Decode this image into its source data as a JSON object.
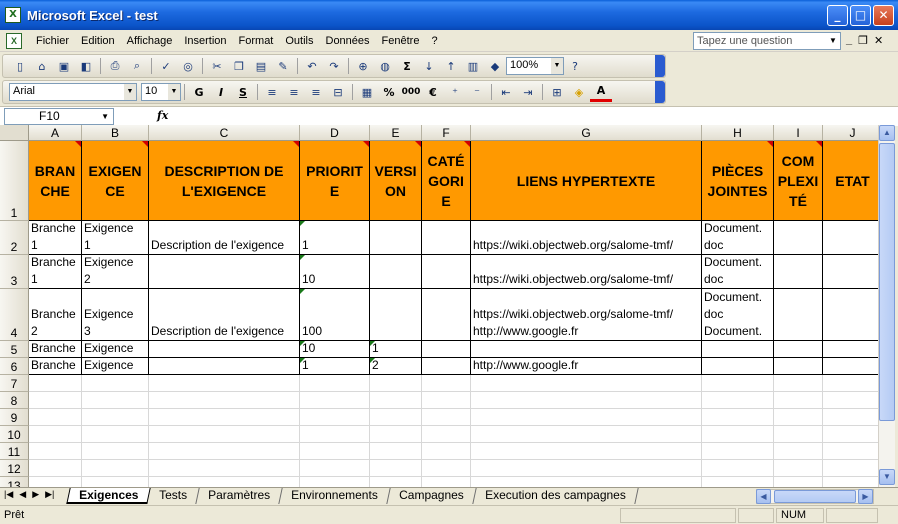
{
  "window": {
    "title": "Microsoft Excel - test",
    "app_icon": "excel-icon"
  },
  "menu": {
    "items": [
      "Fichier",
      "Edition",
      "Affichage",
      "Insertion",
      "Format",
      "Outils",
      "Données",
      "Fenêtre",
      "?"
    ],
    "question_placeholder": "Tapez une question"
  },
  "toolbar": {
    "zoom": "100%",
    "font_name": "Arial",
    "font_size": "10",
    "bold_label": "G",
    "italic_label": "I",
    "underline_label": "S",
    "sum_label": "Σ",
    "percent_label": "%",
    "thousands_label": "000",
    "euro_label": "€"
  },
  "formula_bar": {
    "cell_ref": "F10",
    "fx_label": "fx",
    "value": ""
  },
  "grid": {
    "columns": [
      "A",
      "B",
      "C",
      "D",
      "E",
      "F",
      "G",
      "H",
      "I",
      "J"
    ],
    "rows": [
      "1",
      "2",
      "3",
      "4",
      "5",
      "6",
      "7",
      "8",
      "9",
      "10",
      "11",
      "12",
      "13"
    ],
    "headers": [
      [
        "BRAN",
        "CHE"
      ],
      [
        "EXIGEN",
        "CE"
      ],
      [
        "DESCRIPTION DE",
        "L'EXIGENCE"
      ],
      [
        "PRIORIT",
        "E"
      ],
      [
        "VERSI",
        "ON"
      ],
      [
        "CATÉ",
        "GORI",
        "E"
      ],
      [
        "LIENS HYPERTEXTE"
      ],
      [
        "PIÈCES",
        "JOINTES"
      ],
      [
        "COM",
        "PLEXI",
        "TÉ"
      ],
      [
        "ETAT"
      ]
    ],
    "data_rows": [
      {
        "A": [
          "Branche",
          "1"
        ],
        "B": [
          "Exigence",
          "1"
        ],
        "C": [
          "Description de l'exigence"
        ],
        "D": [
          "1"
        ],
        "E": [
          ""
        ],
        "F": [
          ""
        ],
        "G": [
          "https://wiki.objectweb.org/salome-tmf/"
        ],
        "H": [
          "Document.",
          "doc"
        ],
        "I": [
          ""
        ],
        "J": [
          ""
        ]
      },
      {
        "A": [
          "Branche",
          "1"
        ],
        "B": [
          "Exigence",
          "2"
        ],
        "C": [
          ""
        ],
        "D": [
          "10"
        ],
        "E": [
          ""
        ],
        "F": [
          ""
        ],
        "G": [
          "https://wiki.objectweb.org/salome-tmf/"
        ],
        "H": [
          "Document.",
          "doc"
        ],
        "I": [
          ""
        ],
        "J": [
          ""
        ]
      },
      {
        "A": [
          "Branche",
          "2"
        ],
        "B": [
          "Exigence",
          "3"
        ],
        "C": [
          "Description de l'exigence"
        ],
        "D": [
          "100"
        ],
        "E": [
          ""
        ],
        "F": [
          ""
        ],
        "G": [
          "https://wiki.objectweb.org/salome-tmf/",
          "http://www.google.fr"
        ],
        "H": [
          "Document.",
          "doc",
          "Document."
        ],
        "I": [
          ""
        ],
        "J": [
          ""
        ]
      },
      {
        "A": [
          "Branche"
        ],
        "B": [
          "Exigence"
        ],
        "C": [
          ""
        ],
        "D": [
          "10"
        ],
        "E": [
          "1"
        ],
        "F": [
          ""
        ],
        "G": [
          ""
        ],
        "H": [
          ""
        ],
        "I": [
          ""
        ],
        "J": [
          ""
        ]
      },
      {
        "A": [
          "Branche"
        ],
        "B": [
          "Exigence"
        ],
        "C": [
          ""
        ],
        "D": [
          "1"
        ],
        "E": [
          "2"
        ],
        "F": [
          ""
        ],
        "G": [
          "http://www.google.fr"
        ],
        "H": [
          ""
        ],
        "I": [
          ""
        ],
        "J": [
          ""
        ]
      }
    ]
  },
  "sheets": {
    "tabs": [
      "Exigences",
      "Tests",
      "Paramètres",
      "Environnements",
      "Campagnes",
      "Execution des campagnes"
    ],
    "active": "Exigences"
  },
  "status": {
    "text": "Prêt",
    "num": "NUM"
  },
  "colors": {
    "header_fill": "#ff9900",
    "titlebar": "#0b54c9",
    "comment_marker": "#d00000"
  }
}
